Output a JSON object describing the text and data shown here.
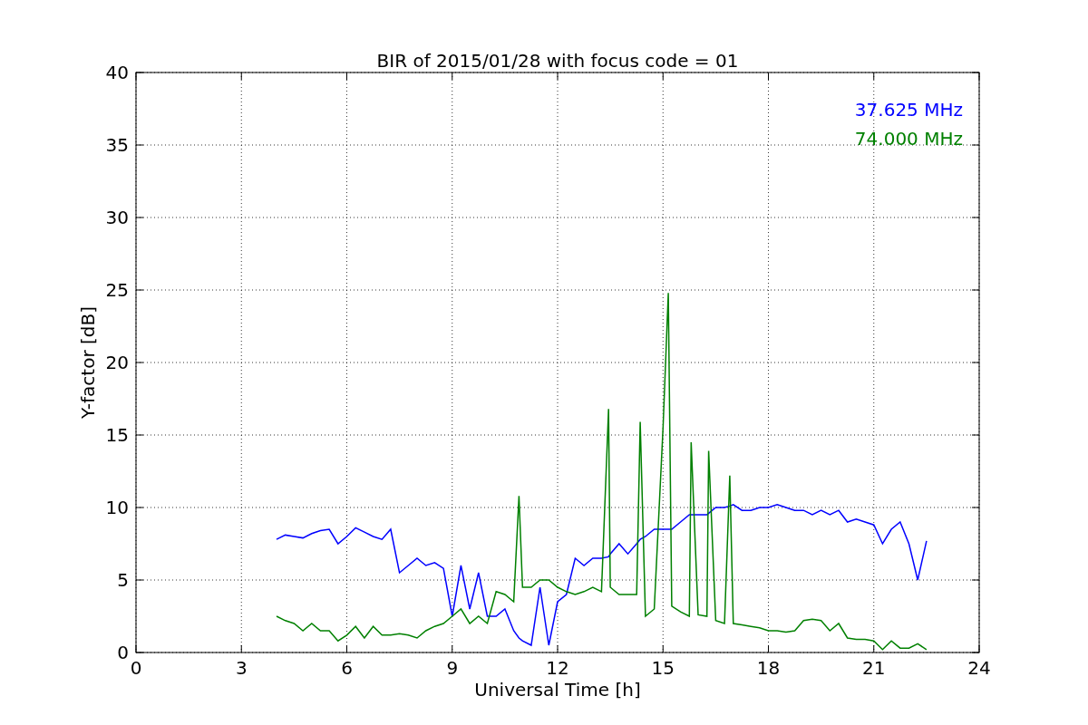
{
  "figure": {
    "chart_data": {
      "type": "line",
      "title": "BIR of 2015/01/28 with focus code = 01",
      "xlabel": "Universal Time [h]",
      "ylabel": "Y-factor [dB]",
      "x": [
        4.0,
        4.25,
        4.5,
        4.75,
        5.0,
        5.25,
        5.5,
        5.75,
        6.0,
        6.25,
        6.5,
        6.75,
        7.0,
        7.25,
        7.5,
        7.75,
        8.0,
        8.25,
        8.5,
        8.75,
        9.0,
        9.25,
        9.5,
        9.75,
        10.0,
        10.25,
        10.5,
        10.75,
        10.9,
        11.0,
        11.25,
        11.5,
        11.75,
        12.0,
        12.25,
        12.5,
        12.75,
        13.0,
        13.25,
        13.45,
        13.5,
        13.75,
        14.0,
        14.25,
        14.35,
        14.5,
        14.75,
        15.0,
        15.15,
        15.25,
        15.5,
        15.75,
        15.8,
        16.0,
        16.25,
        16.3,
        16.5,
        16.75,
        16.9,
        17.0,
        17.25,
        17.5,
        17.75,
        18.0,
        18.25,
        18.5,
        18.75,
        19.0,
        19.25,
        19.5,
        19.75,
        20.0,
        20.25,
        20.5,
        20.75,
        21.0,
        21.25,
        21.5,
        21.75,
        22.0,
        22.25,
        22.5
      ],
      "series": [
        {
          "name": "37.625 MHz",
          "color": "#0000ff",
          "values": [
            7.8,
            8.1,
            8.0,
            7.9,
            8.2,
            8.4,
            8.5,
            7.5,
            8.0,
            8.6,
            8.3,
            8.0,
            7.8,
            8.5,
            5.5,
            6.0,
            6.5,
            6.0,
            6.2,
            5.8,
            2.5,
            6.0,
            3.0,
            5.5,
            2.5,
            2.5,
            3.0,
            1.5,
            1.0,
            0.8,
            0.5,
            4.5,
            0.5,
            3.5,
            4.0,
            6.5,
            6.0,
            6.5,
            6.5,
            6.6,
            6.8,
            7.5,
            6.8,
            7.5,
            7.8,
            8.0,
            8.5,
            8.5,
            8.5,
            8.5,
            9.0,
            9.5,
            9.5,
            9.5,
            9.5,
            9.6,
            10.0,
            10.0,
            10.1,
            10.2,
            9.8,
            9.8,
            10.0,
            10.0,
            10.2,
            10.0,
            9.8,
            9.8,
            9.5,
            9.8,
            9.5,
            9.8,
            9.0,
            9.2,
            9.0,
            8.8,
            7.5,
            8.5,
            9.0,
            7.5,
            5.0,
            7.7
          ]
        },
        {
          "name": "74.000 MHz",
          "color": "#008000",
          "values": [
            2.5,
            2.2,
            2.0,
            1.5,
            2.0,
            1.5,
            1.5,
            0.8,
            1.2,
            1.8,
            1.0,
            1.8,
            1.2,
            1.2,
            1.3,
            1.2,
            1.0,
            1.5,
            1.8,
            2.0,
            2.5,
            3.0,
            2.0,
            2.5,
            2.0,
            4.2,
            4.0,
            3.5,
            10.8,
            4.5,
            4.5,
            5.0,
            5.0,
            4.5,
            4.2,
            4.0,
            4.2,
            4.5,
            4.2,
            16.8,
            4.5,
            4.0,
            4.0,
            4.0,
            15.9,
            2.5,
            3.0,
            15.5,
            24.8,
            3.2,
            2.8,
            2.5,
            14.5,
            2.6,
            2.5,
            13.9,
            2.2,
            2.0,
            12.2,
            2.0,
            1.9,
            1.8,
            1.7,
            1.5,
            1.5,
            1.4,
            1.5,
            2.2,
            2.3,
            2.2,
            1.5,
            2.0,
            1.0,
            0.9,
            0.9,
            0.8,
            0.2,
            0.8,
            0.3,
            0.3,
            0.6,
            0.2
          ]
        }
      ],
      "grid": true,
      "xlim": [
        0,
        24
      ],
      "ylim": [
        0,
        40
      ],
      "xticks": [
        0,
        3,
        6,
        9,
        12,
        15,
        18,
        21,
        24
      ],
      "yticks": [
        0,
        5,
        10,
        15,
        20,
        25,
        30,
        35,
        40
      ]
    }
  }
}
